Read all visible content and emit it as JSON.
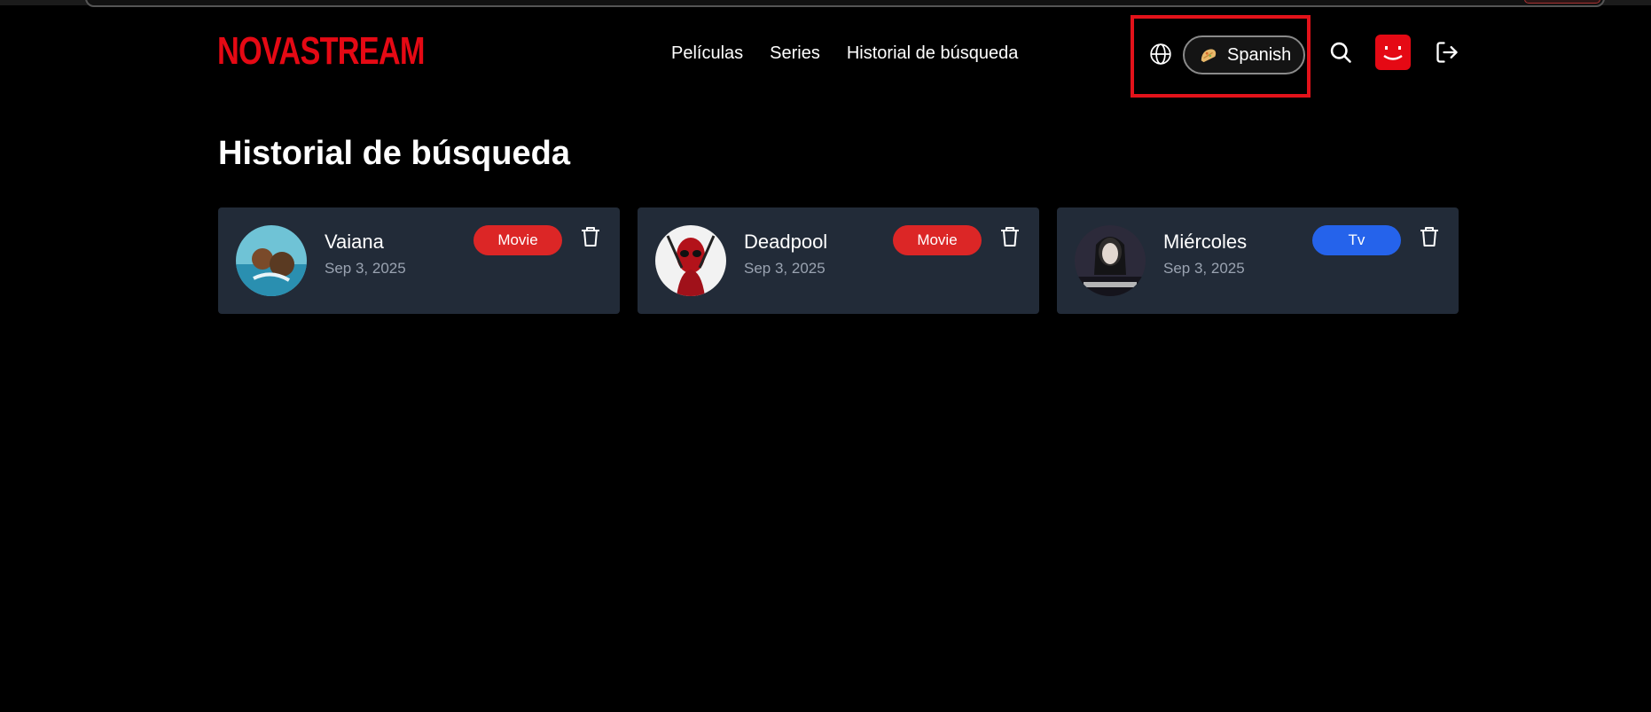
{
  "brand": {
    "logo_text": "NOVASTREAM",
    "accent": "#e50914"
  },
  "nav": {
    "items": [
      {
        "label": "Películas"
      },
      {
        "label": "Series"
      },
      {
        "label": "Historial de búsqueda"
      }
    ]
  },
  "language": {
    "selected_label": "Spanish",
    "flag_icon": "taco-icon",
    "globe_icon": "globe-icon"
  },
  "header_icons": {
    "search": "search-icon",
    "avatar": "avatar",
    "logout": "logout-icon"
  },
  "page": {
    "title": "Historial de búsqueda"
  },
  "history": [
    {
      "title": "Vaiana",
      "date": "Sep 3, 2025",
      "type": "Movie",
      "type_color": "#dc2626"
    },
    {
      "title": "Deadpool",
      "date": "Sep 3, 2025",
      "type": "Movie",
      "type_color": "#dc2626"
    },
    {
      "title": "Miércoles",
      "date": "Sep 3, 2025",
      "type": "Tv",
      "type_color": "#2563eb"
    }
  ],
  "colors": {
    "card_bg": "#222b38",
    "date_text": "#9aa3b1",
    "highlight": "#e3121a"
  }
}
